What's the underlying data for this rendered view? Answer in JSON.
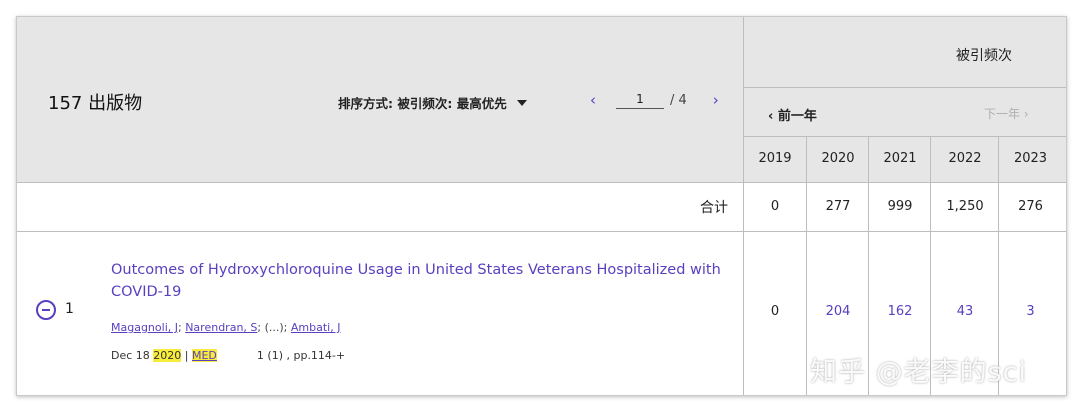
{
  "results": {
    "count_label": "157 出版物",
    "sort_label": "排序方式: 被引频次: 最高优先",
    "pager": {
      "prev": "‹",
      "current": "1",
      "total": "/ 4",
      "next": "›"
    }
  },
  "citations": {
    "title": "被引频次",
    "prev_year": "‹ 前一年",
    "next_year": "下一年 ›",
    "years": [
      "2019",
      "2020",
      "2021",
      "2022",
      "2023"
    ],
    "total_label": "合计",
    "totals": [
      "0",
      "277",
      "999",
      "1,250",
      "276"
    ]
  },
  "records": [
    {
      "number": "1",
      "title": "Outcomes of Hydroxychloroquine Usage in United States Veterans Hospitalized with COVID-19",
      "authors": [
        "Magagnoli, J",
        "Narendran, S",
        "Ambati, J"
      ],
      "author_sep": "; ",
      "ellipsis": "; (...); ",
      "date_prefix": "Dec 18 ",
      "year": "2020",
      "sep": " | ",
      "source": "MED",
      "volume": "1 (1) , pp.114-+",
      "citations": [
        "0",
        "204",
        "162",
        "43",
        "3"
      ]
    }
  ],
  "watermark": "知乎 @老李的sci",
  "colors": {
    "link": "#5a3fc0",
    "highlight": "#f7ec3b",
    "header_bg": "#e6e6e6"
  }
}
